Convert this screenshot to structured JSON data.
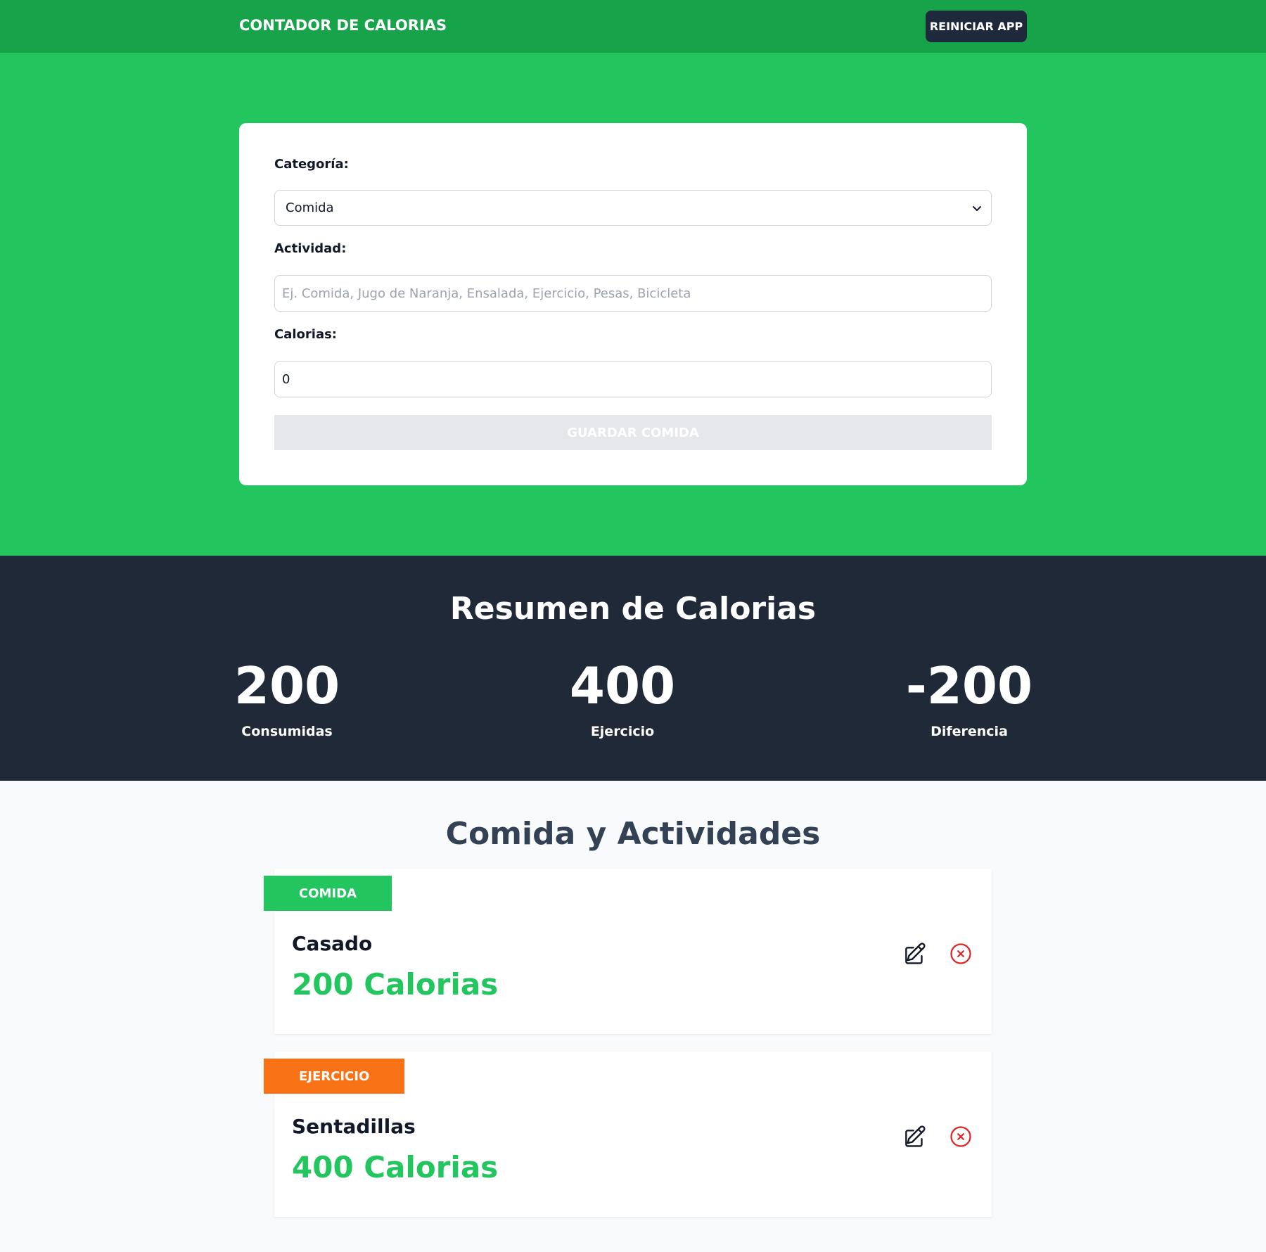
{
  "header": {
    "title": "CONTADOR DE CALORIAS",
    "reset_label": "REINICIAR APP"
  },
  "form": {
    "category_label": "Categoría:",
    "category_value": "Comida",
    "activity_label": "Actividad:",
    "activity_placeholder": "Ej. Comida, Jugo de Naranja, Ensalada, Ejercicio, Pesas, Bicicleta",
    "activity_value": "",
    "calories_label": "Calorias:",
    "calories_value": "0",
    "save_label": "GUARDAR COMIDA"
  },
  "summary": {
    "title": "Resumen de Calorias",
    "consumed_value": "200",
    "consumed_label": "Consumidas",
    "exercise_value": "400",
    "exercise_label": "Ejercicio",
    "difference_value": "-200",
    "difference_label": "Diferencia"
  },
  "activities": {
    "title": "Comida y Actividades",
    "items": [
      {
        "category": "COMIDA",
        "name": "Casado",
        "calories": "200 Calorias"
      },
      {
        "category": "EJERCICIO",
        "name": "Sentadillas",
        "calories": "400 Calorias"
      }
    ]
  },
  "colors": {
    "header_green": "#16a34a",
    "section_green": "#22c55e",
    "dark": "#1f2937",
    "food_badge": "#22c55e",
    "exercise_badge": "#f97316",
    "delete_red": "#dc2626"
  },
  "icons": {
    "edit": "pencil-square-icon",
    "delete": "x-circle-icon",
    "select": "chevron-down-icon"
  }
}
